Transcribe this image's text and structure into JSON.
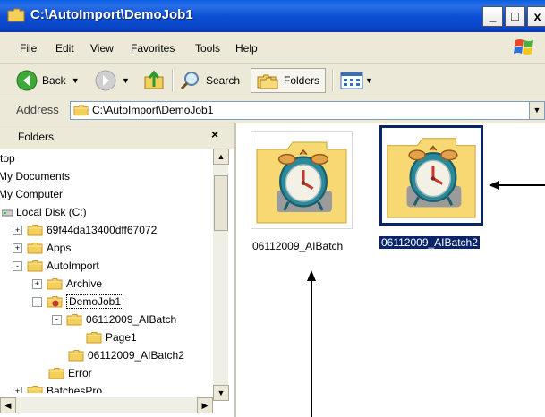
{
  "window": {
    "title": "C:\\AutoImport\\DemoJob1",
    "buttons": {
      "minimize": "_",
      "maximize": "□",
      "close": "x"
    }
  },
  "menu": [
    "File",
    "Edit",
    "View",
    "Favorites",
    "Tools",
    "Help"
  ],
  "toolbar": {
    "back_label": "Back",
    "search_label": "Search",
    "folders_label": "Folders"
  },
  "address": {
    "label": "Address",
    "value": "C:\\AutoImport\\DemoJob1"
  },
  "folders_pane": {
    "title": "Folders",
    "close": "×",
    "tree": [
      {
        "label": "top",
        "icon": null,
        "expander": null
      },
      {
        "label": "My Documents",
        "icon": null,
        "expander": null
      },
      {
        "label": "My Computer",
        "icon": null,
        "expander": null
      },
      {
        "label": "Local Disk (C:)",
        "icon": "drive-icon",
        "expander": null
      },
      {
        "label": "69f44da13400dff67072",
        "icon": "folder-icon",
        "expander": "+"
      },
      {
        "label": "Apps",
        "icon": "folder-icon",
        "expander": "+"
      },
      {
        "label": "AutoImport",
        "icon": "folder-icon",
        "expander": "-"
      },
      {
        "label": "Archive",
        "icon": "folder-icon",
        "expander": "+"
      },
      {
        "label": "DemoJob1",
        "icon": "special-folder-icon",
        "expander": "-"
      },
      {
        "label": "06112009_AIBatch",
        "icon": "folder-icon",
        "expander": "-"
      },
      {
        "label": "Page1",
        "icon": "folder-icon",
        "expander": null
      },
      {
        "label": "06112009_AIBatch2",
        "icon": "folder-icon",
        "expander": null
      },
      {
        "label": "Error",
        "icon": "folder-icon",
        "expander": null
      },
      {
        "label": "BatchesPro",
        "icon": "folder-icon",
        "expander": "+"
      }
    ]
  },
  "main": {
    "items": [
      {
        "label": "06112009_AIBatch",
        "selected": false
      },
      {
        "label": "06112009_AIBatch2",
        "selected": true
      }
    ]
  },
  "colors": {
    "titlebar": "#0a4fd6",
    "chrome": "#ece9d8",
    "selection": "#0a246a"
  }
}
